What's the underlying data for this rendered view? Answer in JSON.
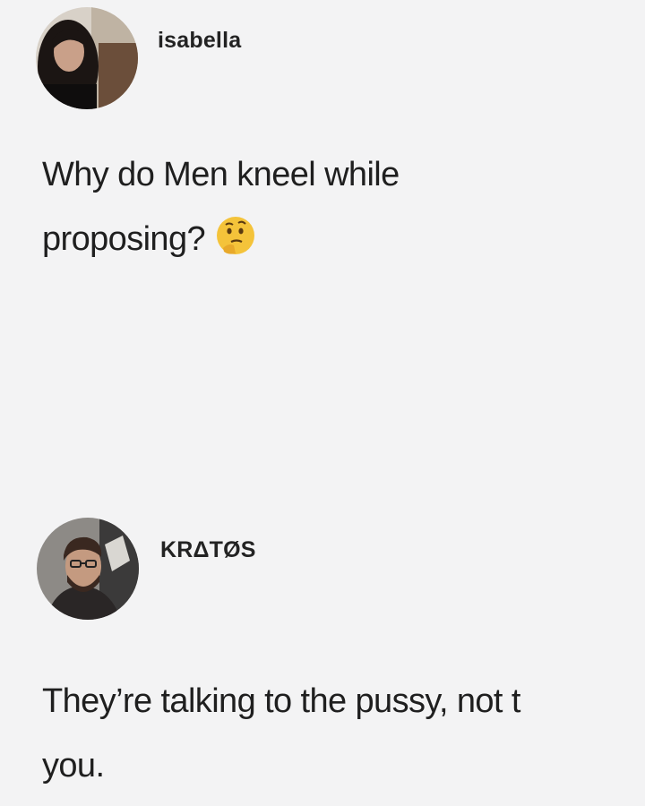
{
  "posts": [
    {
      "author": "isabella",
      "avatar_icon": "profile-photo-woman",
      "lines": [
        "Why do Men kneel while",
        "proposing?"
      ],
      "emoji": "thinking-face-emoji"
    },
    {
      "author": "KRΔTØS",
      "avatar_icon": "profile-photo-man",
      "lines": [
        "They’re talking to the pussy, not t",
        "you."
      ]
    }
  ],
  "colors": {
    "background": "#f3f3f4",
    "text": "#1f1f1f",
    "emoji": "#f4c33a"
  }
}
